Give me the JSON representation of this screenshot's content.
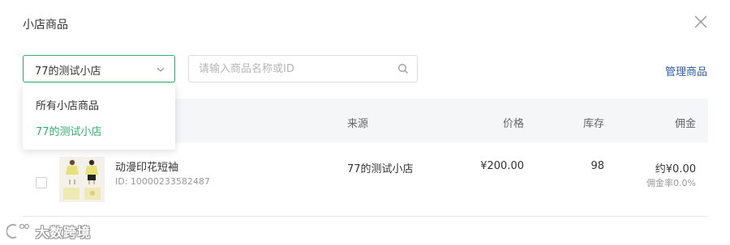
{
  "dialog": {
    "title": "小店商品"
  },
  "filter": {
    "shop_select_value": "77的测试小店",
    "search_placeholder": "请输入商品名称或ID",
    "manage_link": "管理商品"
  },
  "dropdown": {
    "options": [
      {
        "label": "所有小店商品",
        "selected": false
      },
      {
        "label": "77的测试小店",
        "selected": true
      }
    ]
  },
  "table": {
    "headers": {
      "source": "来源",
      "price": "价格",
      "stock": "库存",
      "commission": "佣金"
    },
    "rows": [
      {
        "name": "动漫印花短袖",
        "id": "ID: 10000233582487",
        "source": "77的测试小店",
        "price": "¥200.00",
        "stock": "98",
        "commission": "约¥0.00",
        "commission_rate": "佣金率0.0%"
      }
    ]
  },
  "watermark": {
    "text": "大数跨境"
  },
  "colors": {
    "accent": "#2db36b",
    "link": "#2d5ea8",
    "header_bg": "#f5f6f8"
  },
  "icons": [
    "close-icon",
    "chevron-down-icon",
    "search-icon"
  ]
}
